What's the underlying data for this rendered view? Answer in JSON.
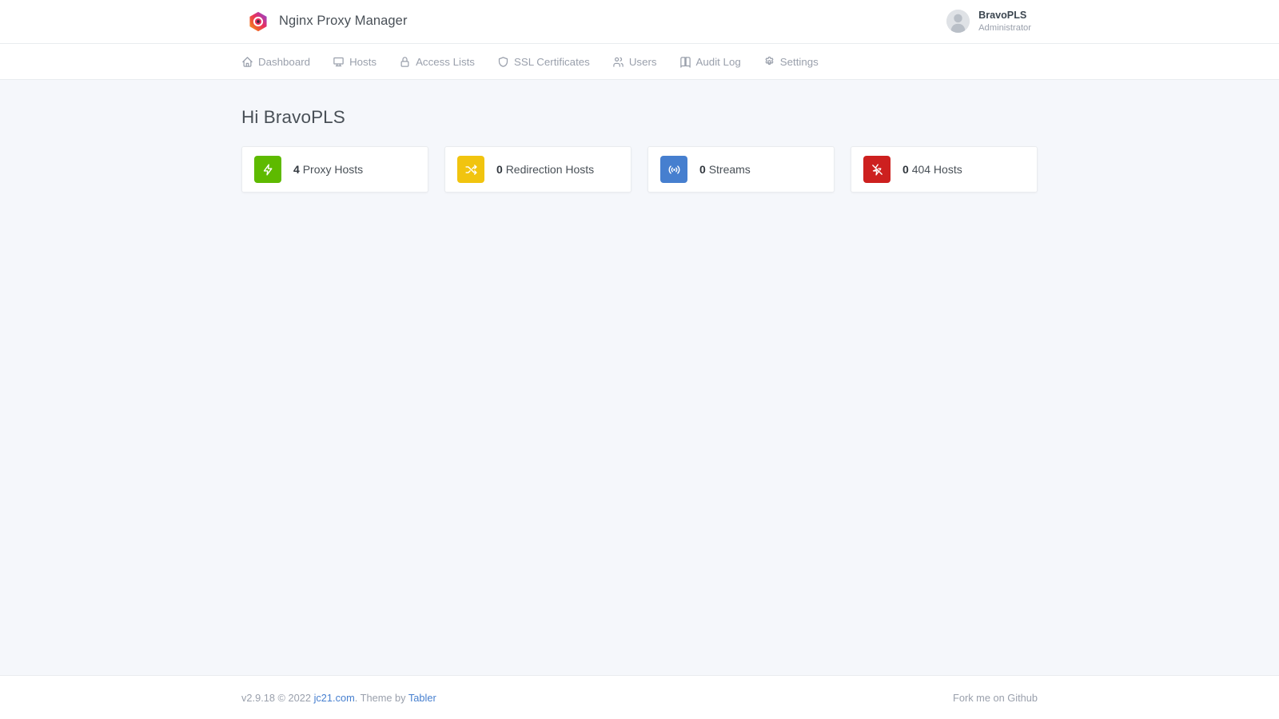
{
  "header": {
    "brand_title": "Nginx Proxy Manager",
    "logo_icon": "npm-hexagon-logo-icon",
    "user": {
      "avatar_icon": "user-avatar-icon",
      "name": "BravoPLS",
      "role": "Administrator"
    }
  },
  "nav": {
    "items": [
      {
        "label": "Dashboard",
        "icon": "home-icon",
        "active": true
      },
      {
        "label": "Hosts",
        "icon": "monitor-icon",
        "active": false
      },
      {
        "label": "Access Lists",
        "icon": "lock-icon",
        "active": false
      },
      {
        "label": "SSL Certificates",
        "icon": "shield-icon",
        "active": false
      },
      {
        "label": "Users",
        "icon": "users-icon",
        "active": false
      },
      {
        "label": "Audit Log",
        "icon": "book-icon",
        "active": false
      },
      {
        "label": "Settings",
        "icon": "gear-icon",
        "active": false
      }
    ]
  },
  "main": {
    "page_title": "Hi BravoPLS",
    "stats": [
      {
        "count": "4",
        "label": "Proxy Hosts",
        "icon": "bolt-icon",
        "color": "#5eba00"
      },
      {
        "count": "0",
        "label": "Redirection Hosts",
        "icon": "shuffle-icon",
        "color": "#f1c40f"
      },
      {
        "count": "0",
        "label": "Streams",
        "icon": "broadcast-icon",
        "color": "#467fcf"
      },
      {
        "count": "0",
        "label": "404 Hosts",
        "icon": "bolt-off-icon",
        "color": "#cd201f"
      }
    ]
  },
  "footer": {
    "version": "v2.9.18 © 2022",
    "site_link": "jc21.com",
    "theme_prefix": ". Theme by ",
    "theme_link": "Tabler",
    "github_link": "Fork me on Github"
  }
}
